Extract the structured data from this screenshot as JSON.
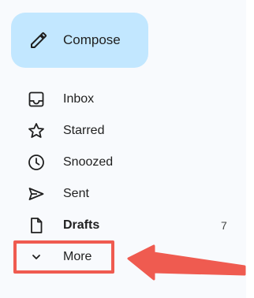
{
  "compose": {
    "label": "Compose",
    "icon": "pencil-icon"
  },
  "nav": {
    "items": [
      {
        "label": "Inbox",
        "icon": "inbox-icon",
        "bold": false,
        "count": ""
      },
      {
        "label": "Starred",
        "icon": "star-icon",
        "bold": false,
        "count": ""
      },
      {
        "label": "Snoozed",
        "icon": "clock-icon",
        "bold": false,
        "count": ""
      },
      {
        "label": "Sent",
        "icon": "send-icon",
        "bold": false,
        "count": ""
      },
      {
        "label": "Drafts",
        "icon": "draft-icon",
        "bold": true,
        "count": "7"
      },
      {
        "label": "More",
        "icon": "chevron-down-icon",
        "bold": false,
        "count": ""
      }
    ]
  },
  "annotation": {
    "color": "#ef5b50",
    "target": "More"
  },
  "colors": {
    "background": "#f8fafd",
    "compose_bg": "#c2e7ff",
    "text": "#1f1f1f"
  }
}
